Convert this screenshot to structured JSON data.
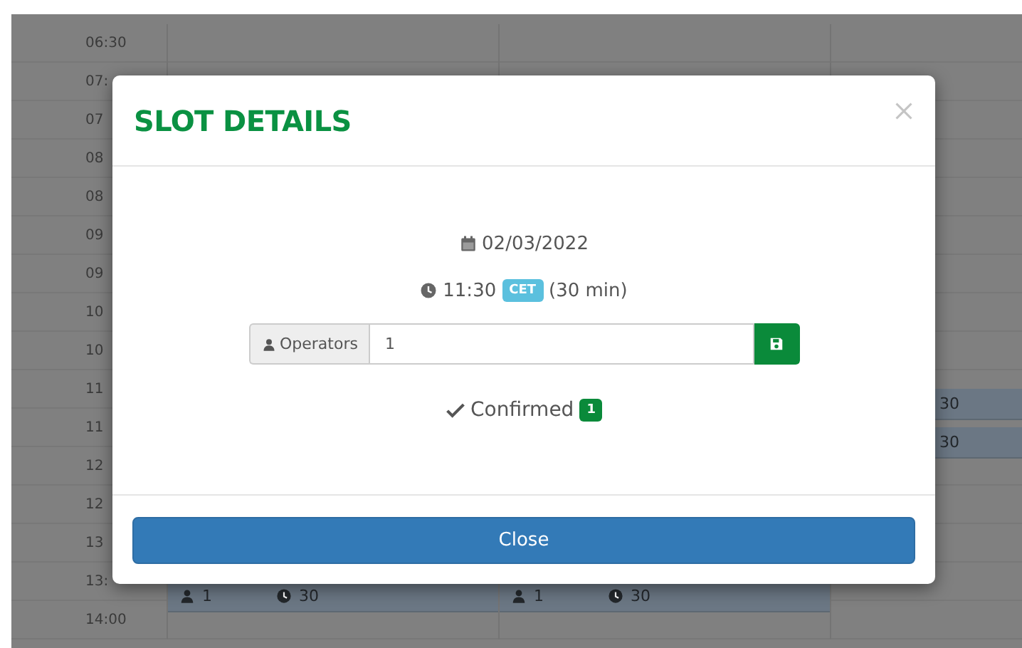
{
  "calendar": {
    "rows": [
      {
        "time": "06:30",
        "slots": [
          {
            "kind": "empty"
          },
          {
            "kind": "empty"
          },
          {
            "kind": "empty"
          }
        ]
      },
      {
        "time": "07:",
        "slots": [
          {
            "kind": "empty"
          },
          {
            "kind": "empty"
          },
          {
            "kind": "empty"
          }
        ]
      },
      {
        "time": "07",
        "slots": [
          {
            "kind": "empty"
          },
          {
            "kind": "empty"
          },
          {
            "kind": "empty"
          }
        ]
      },
      {
        "time": "08",
        "slots": [
          {
            "kind": "empty"
          },
          {
            "kind": "empty"
          },
          {
            "kind": "empty"
          }
        ]
      },
      {
        "time": "08",
        "slots": [
          {
            "kind": "empty"
          },
          {
            "kind": "empty"
          },
          {
            "kind": "empty"
          }
        ]
      },
      {
        "time": "09",
        "slots": [
          {
            "kind": "empty"
          },
          {
            "kind": "empty"
          },
          {
            "kind": "empty"
          }
        ]
      },
      {
        "time": "09",
        "slots": [
          {
            "kind": "empty"
          },
          {
            "kind": "empty"
          },
          {
            "kind": "empty"
          }
        ]
      },
      {
        "time": "10",
        "slots": [
          {
            "kind": "empty"
          },
          {
            "kind": "empty"
          },
          {
            "kind": "empty"
          }
        ]
      },
      {
        "time": "10",
        "slots": [
          {
            "kind": "empty"
          },
          {
            "kind": "empty"
          },
          {
            "kind": "empty"
          }
        ]
      },
      {
        "time": "11",
        "slots": [
          {
            "kind": "empty"
          },
          {
            "kind": "empty"
          },
          {
            "kind": "empty"
          }
        ]
      },
      {
        "time": "11",
        "slots": [
          {
            "kind": "empty"
          },
          {
            "kind": "empty"
          },
          {
            "kind": "duration",
            "duration": "30"
          }
        ]
      },
      {
        "time": "12",
        "slots": [
          {
            "kind": "empty"
          },
          {
            "kind": "empty"
          },
          {
            "kind": "duration",
            "duration": "30"
          }
        ]
      },
      {
        "time": "12",
        "slots": [
          {
            "kind": "empty"
          },
          {
            "kind": "empty"
          },
          {
            "kind": "empty"
          }
        ]
      },
      {
        "time": "13",
        "slots": [
          {
            "kind": "empty"
          },
          {
            "kind": "empty"
          },
          {
            "kind": "empty"
          }
        ]
      },
      {
        "time": "13:",
        "slots": [
          {
            "kind": "empty"
          },
          {
            "kind": "empty"
          },
          {
            "kind": "empty"
          }
        ]
      },
      {
        "time": "14:00",
        "slots": [
          {
            "kind": "full",
            "operators": "1",
            "duration": "30"
          },
          {
            "kind": "full",
            "operators": "1",
            "duration": "30"
          },
          {
            "kind": "empty"
          }
        ]
      }
    ]
  },
  "modal": {
    "title": "SLOT DETAILS",
    "date": "02/03/2022",
    "time": "11:30",
    "timezone": "CET",
    "duration": "(30 min)",
    "operators": {
      "label": "Operators",
      "value": "1"
    },
    "status": {
      "label": "Confirmed",
      "count": "1"
    },
    "button": "Close"
  }
}
